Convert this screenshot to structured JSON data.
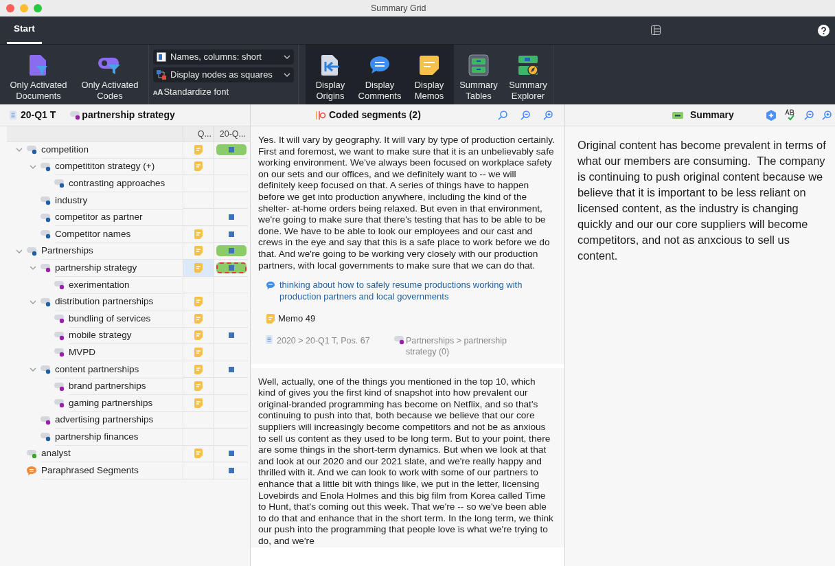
{
  "window": {
    "title": "Summary Grid"
  },
  "tabs": [
    {
      "label": "Start",
      "selected": true
    }
  ],
  "ribbon": {
    "left_buttons": [
      {
        "label": "Only Activated Documents",
        "kind": "documents",
        "on": false
      },
      {
        "label": "Only Activated Codes",
        "kind": "codes",
        "on": false
      }
    ],
    "dropdowns": [
      {
        "label": "Names, columns: short",
        "kind": "names"
      },
      {
        "label": "Display nodes as squares",
        "kind": "nodes"
      }
    ],
    "standardize": {
      "glyph": "ᴀA",
      "label": "Standardize font"
    },
    "right_buttons": [
      {
        "label": "Display Origins",
        "kind": "origins",
        "on": true
      },
      {
        "label": "Display Comments",
        "kind": "comments",
        "on": true
      },
      {
        "label": "Display Memos",
        "kind": "memos",
        "on": true
      },
      {
        "label": "Summary Tables",
        "kind": "tables",
        "on": false
      },
      {
        "label": "Summary Explorer",
        "kind": "explorer",
        "on": false
      }
    ]
  },
  "left_panel": {
    "document": "20-Q1 T",
    "code": {
      "name": "partnership strategy",
      "color": "#9b1fa8"
    },
    "columns": [
      "Q...",
      "20-Q..."
    ],
    "codes": [
      {
        "name": "competition",
        "kind": "code",
        "color": "#1f5fa8",
        "expanded": true,
        "memo": true,
        "cell": {
          "kind": "bar"
        },
        "selected": false,
        "children": [
          {
            "name": "competititon strategy (+)",
            "kind": "code",
            "color": "#1f5fa8",
            "expanded": true,
            "memo": true,
            "selected": false,
            "children": [
              {
                "name": "contrasting approaches",
                "kind": "code",
                "color": "#1f5fa8",
                "memo": false,
                "selected": false
              }
            ]
          },
          {
            "name": "industry",
            "kind": "code",
            "color": "#1f5fa8",
            "memo": false,
            "selected": false
          },
          {
            "name": "competitor as partner",
            "kind": "code",
            "color": "#1f5fa8",
            "memo": false,
            "cell": {
              "kind": "square"
            },
            "selected": false
          },
          {
            "name": "Competitor names",
            "kind": "code",
            "color": "#1f5fa8",
            "memo": true,
            "cell": {
              "kind": "square"
            },
            "selected": false
          }
        ]
      },
      {
        "name": "Partnerships",
        "kind": "code",
        "color": "#1f5fa8",
        "expanded": true,
        "memo": true,
        "cell": {
          "kind": "bar"
        },
        "selected": false,
        "children": [
          {
            "name": "partnership strategy",
            "kind": "code",
            "color": "#9b1fa8",
            "expanded": true,
            "memo": true,
            "cell": {
              "kind": "bar"
            },
            "selected": true,
            "children": [
              {
                "name": "exerimentation",
                "kind": "code",
                "color": "#9b1fa8",
                "memo": false,
                "selected": false
              }
            ]
          },
          {
            "name": "distribution partnerships",
            "kind": "code",
            "color": "#1f5fa8",
            "expanded": true,
            "memo": true,
            "selected": false,
            "children": [
              {
                "name": "bundling of services",
                "kind": "code",
                "color": "#9b1fa8",
                "memo": true,
                "selected": false
              },
              {
                "name": "mobile strategy",
                "kind": "code",
                "color": "#9b1fa8",
                "memo": true,
                "cell": {
                  "kind": "square"
                },
                "selected": false
              },
              {
                "name": "MVPD",
                "kind": "code",
                "color": "#9b1fa8",
                "memo": true,
                "selected": false
              }
            ]
          },
          {
            "name": "content partnerships",
            "kind": "code",
            "color": "#1f5fa8",
            "expanded": true,
            "memo": true,
            "cell": {
              "kind": "square"
            },
            "selected": false,
            "children": [
              {
                "name": "brand partnerships",
                "kind": "code",
                "color": "#9b1fa8",
                "memo": true,
                "selected": false
              },
              {
                "name": "gaming partnerships",
                "kind": "code",
                "color": "#9b1fa8",
                "memo": true,
                "selected": false
              }
            ]
          },
          {
            "name": "advertising partnerships",
            "kind": "code",
            "color": "#9b1fa8",
            "memo": false,
            "selected": false
          },
          {
            "name": "partnership finances",
            "kind": "code",
            "color": "#1f5fa8",
            "memo": false,
            "selected": false
          }
        ]
      },
      {
        "name": "analyst",
        "kind": "code",
        "color": "#3fa62a",
        "memo": true,
        "cell": {
          "kind": "square"
        },
        "selected": false
      },
      {
        "name": "Paraphrased Segments",
        "kind": "paraphrase",
        "memo": false,
        "cell": {
          "kind": "square"
        },
        "selected": false
      }
    ]
  },
  "middle_panel": {
    "title": "Coded segments (2)",
    "segments": [
      {
        "text": "Yes. It will vary by geography. It will vary by type of production certainly. First and foremost, we want to make sure that it is an unbelievably safe working environment. We've always been focused on workplace safety on our sets and our offices, and we definitely want to -- we will definitely keep focused on that. A series of things have to happen before we get into production anywhere, including the kind of the shelter- at-home orders being relaxed. But even in that environment, we're going to make sure that there's testing that has to be able to be done. We have to be able to look our employees and our cast and crews in the eye and say that this is a safe place to work before we do that. And we're going to be working very closely with our production partners, with local governments to make sure that we can do that.",
        "comment": "thinking about how to safely resume productions working with production partners and local governments",
        "memo": "Memo 49",
        "source": "2020 > 20-Q1 T, Pos. 67",
        "code": {
          "path": "Partnerships > partnership strategy (0)",
          "color": "#9b1fa8"
        }
      },
      {
        "text": "Well, actually, one of the things you mentioned in the top 10, which kind of gives you the first kind of snapshot into how prevalent our original-branded programming has become on Netflix, and so that's continuing to push into that, both because we believe that our core suppliers will increasingly become competitors and not be as anxious to sell us content as they used to be long term. But to your point, there are some things in the short-term dynamics. But when we look at that and look at our 2020 and our 2021 slate, and we're really happy and thrilled with it. And we can look to work with some of our partners to enhance that a little bit with things like, we put in the letter, licensing Lovebirds and Enola Holmes and this big film from Korea called Time to Hunt, that's coming out this week. That we're -- so we've been able to do that and enhance that in the short term. In the long term, we think our push into the programming that people love is what we're trying to do, and we're"
      }
    ]
  },
  "right_panel": {
    "title": "Summary",
    "text": "Original content has become prevalent in terms of what our members are consuming.  The company is continuing to push original content because we believe that it is important to be less reliant on licensed content, as the industry is changing quickly and our our core suppliers will become competitors, and not as anxcious to sell us content."
  }
}
